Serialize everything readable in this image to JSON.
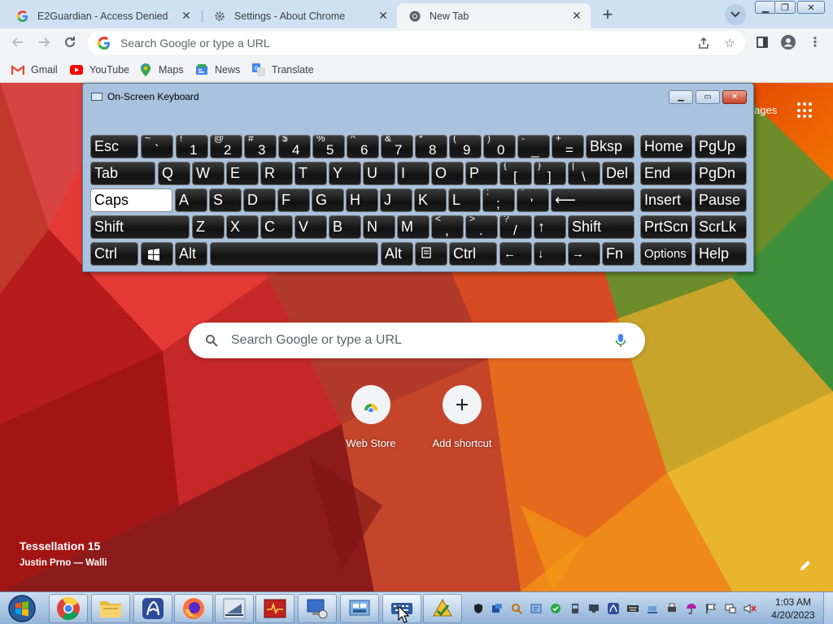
{
  "browser": {
    "tabs": [
      {
        "label": "E2Guardian - Access Denied",
        "icon": "google-g-icon",
        "active": false
      },
      {
        "label": "Settings - About Chrome",
        "icon": "gear-icon",
        "active": false
      },
      {
        "label": "New Tab",
        "icon": "chrome-icon",
        "active": true
      }
    ],
    "omnibox_placeholder": "Search Google or type a URL",
    "bookmarks": [
      {
        "label": "Gmail",
        "icon": "gmail-icon"
      },
      {
        "label": "YouTube",
        "icon": "youtube-icon"
      },
      {
        "label": "Maps",
        "icon": "maps-icon"
      },
      {
        "label": "News",
        "icon": "news-icon"
      },
      {
        "label": "Translate",
        "icon": "translate-icon"
      }
    ]
  },
  "newtab": {
    "images_link": "ages",
    "search_placeholder": "Search Google or type a URL",
    "shortcuts": [
      {
        "label": "Web Store",
        "icon": "web-store-icon"
      },
      {
        "label": "Add shortcut",
        "icon": "plus-icon"
      }
    ],
    "background_title": "Tessellation 15",
    "background_author": "Justin Prno — Walli"
  },
  "osk": {
    "title": "On-Screen Keyboard",
    "keys": {
      "esc": "Esc",
      "bksp": "Bksp",
      "home": "Home",
      "pgup": "PgUp",
      "tab": "Tab",
      "del": "Del",
      "end": "End",
      "pgdn": "PgDn",
      "caps": "Caps",
      "insert": "Insert",
      "pause": "Pause",
      "shift_l": "Shift",
      "shift_r": "Shift",
      "prtscn": "PrtScn",
      "scrlk": "ScrLk",
      "ctrl_l": "Ctrl",
      "alt_l": "Alt",
      "alt_r": "Alt",
      "ctrl_r": "Ctrl",
      "fn": "Fn",
      "options": "Options",
      "help": "Help",
      "row1_digits": [
        {
          "up": "~",
          "low": "`"
        },
        {
          "up": "!",
          "low": "1"
        },
        {
          "up": "@",
          "low": "2"
        },
        {
          "up": "#",
          "low": "3"
        },
        {
          "up": "$",
          "low": "4"
        },
        {
          "up": "%",
          "low": "5"
        },
        {
          "up": "^",
          "low": "6"
        },
        {
          "up": "&",
          "low": "7"
        },
        {
          "up": "*",
          "low": "8"
        },
        {
          "up": "(",
          "low": "9"
        },
        {
          "up": ")",
          "low": "0"
        },
        {
          "up": "-",
          "low": "_"
        },
        {
          "up": "+",
          "low": "="
        }
      ],
      "row2_letters": [
        "Q",
        "W",
        "E",
        "R",
        "T",
        "Y",
        "U",
        "I",
        "O",
        "P"
      ],
      "row2_symbols": [
        {
          "up": "{",
          "low": "["
        },
        {
          "up": "}",
          "low": "]"
        },
        {
          "up": "|",
          "low": "\\"
        }
      ],
      "row3_letters": [
        "A",
        "S",
        "D",
        "F",
        "G",
        "H",
        "J",
        "K",
        "L"
      ],
      "row3_symbols": [
        {
          "up": ":",
          "low": ";"
        },
        {
          "up": "\"",
          "low": "'"
        }
      ],
      "row4_letters": [
        "Z",
        "X",
        "C",
        "V",
        "B",
        "N",
        "M"
      ],
      "row4_symbols": [
        {
          "up": "<",
          "low": ","
        },
        {
          "up": ">",
          "low": "."
        },
        {
          "up": "?",
          "low": "/"
        }
      ],
      "arrows": {
        "up": "↑",
        "left": "←",
        "down": "↓",
        "right": "→"
      },
      "enter": "⟵"
    }
  },
  "taskbar": {
    "apps": [
      "chrome-icon",
      "file-explorer-icon",
      "arch-icon",
      "firefox-icon",
      "ship-icon",
      "monitor-app-icon",
      "remote-desktop-icon",
      "network-icon",
      "on-screen-keyboard-icon",
      "security-check-icon"
    ],
    "clock_time": "1:03 AM",
    "clock_date": "4/20/2023"
  }
}
